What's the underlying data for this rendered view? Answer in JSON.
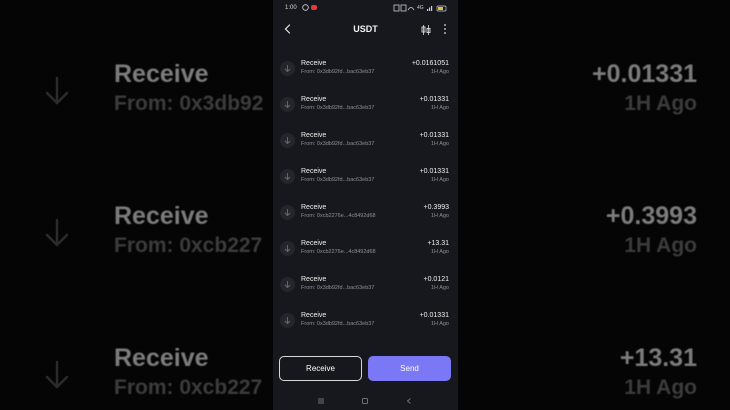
{
  "status_bar": {
    "time": "1:00",
    "net_label": "4G"
  },
  "header": {
    "title": "USDT"
  },
  "transactions": [
    {
      "type": "Receive",
      "from": "From: 0x3db92fd...bac63eb37",
      "amount": "+0.0161051",
      "time": "1H Ago"
    },
    {
      "type": "Receive",
      "from": "From: 0x3db92fd...bac63eb37",
      "amount": "+0.01331",
      "time": "1H Ago"
    },
    {
      "type": "Receive",
      "from": "From: 0x3db92fd...bac63eb37",
      "amount": "+0.01331",
      "time": "1H Ago"
    },
    {
      "type": "Receive",
      "from": "From: 0x3db92fd...bac63eb37",
      "amount": "+0.01331",
      "time": "1H Ago"
    },
    {
      "type": "Receive",
      "from": "From: 0xcb2276e...4c8492d68",
      "amount": "+0.3993",
      "time": "1H Ago"
    },
    {
      "type": "Receive",
      "from": "From: 0xcb2276e...4c8492d68",
      "amount": "+13.31",
      "time": "1H Ago"
    },
    {
      "type": "Receive",
      "from": "From: 0x3db92fd...bac63eb37",
      "amount": "+0.0121",
      "time": "1H Ago"
    },
    {
      "type": "Receive",
      "from": "From: 0x3db92fd...bac63eb37",
      "amount": "+0.01331",
      "time": "1H Ago"
    }
  ],
  "actions": {
    "receive_label": "Receive",
    "send_label": "Send"
  },
  "background": {
    "left": [
      {
        "type": "Receive",
        "from": "From: 0x3db92"
      },
      {
        "type": "Receive",
        "from": "From: 0xcb227"
      },
      {
        "type": "Receive",
        "from": "From: 0xcb227"
      }
    ],
    "right": [
      {
        "amount": "+0.01331",
        "time": "1H Ago"
      },
      {
        "amount": "+0.3993",
        "time": "1H Ago"
      },
      {
        "amount": "+13.31",
        "time": "1H Ago"
      }
    ]
  },
  "colors": {
    "accent": "#7b78f5",
    "screen_bg": "#17181d",
    "muted": "#8f9196"
  },
  "icons": [
    "back-arrow-icon",
    "kline-chart-icon",
    "more-vertical-icon",
    "receive-arrow-icon",
    "nav-menu-icon",
    "nav-home-icon",
    "nav-back-icon"
  ]
}
